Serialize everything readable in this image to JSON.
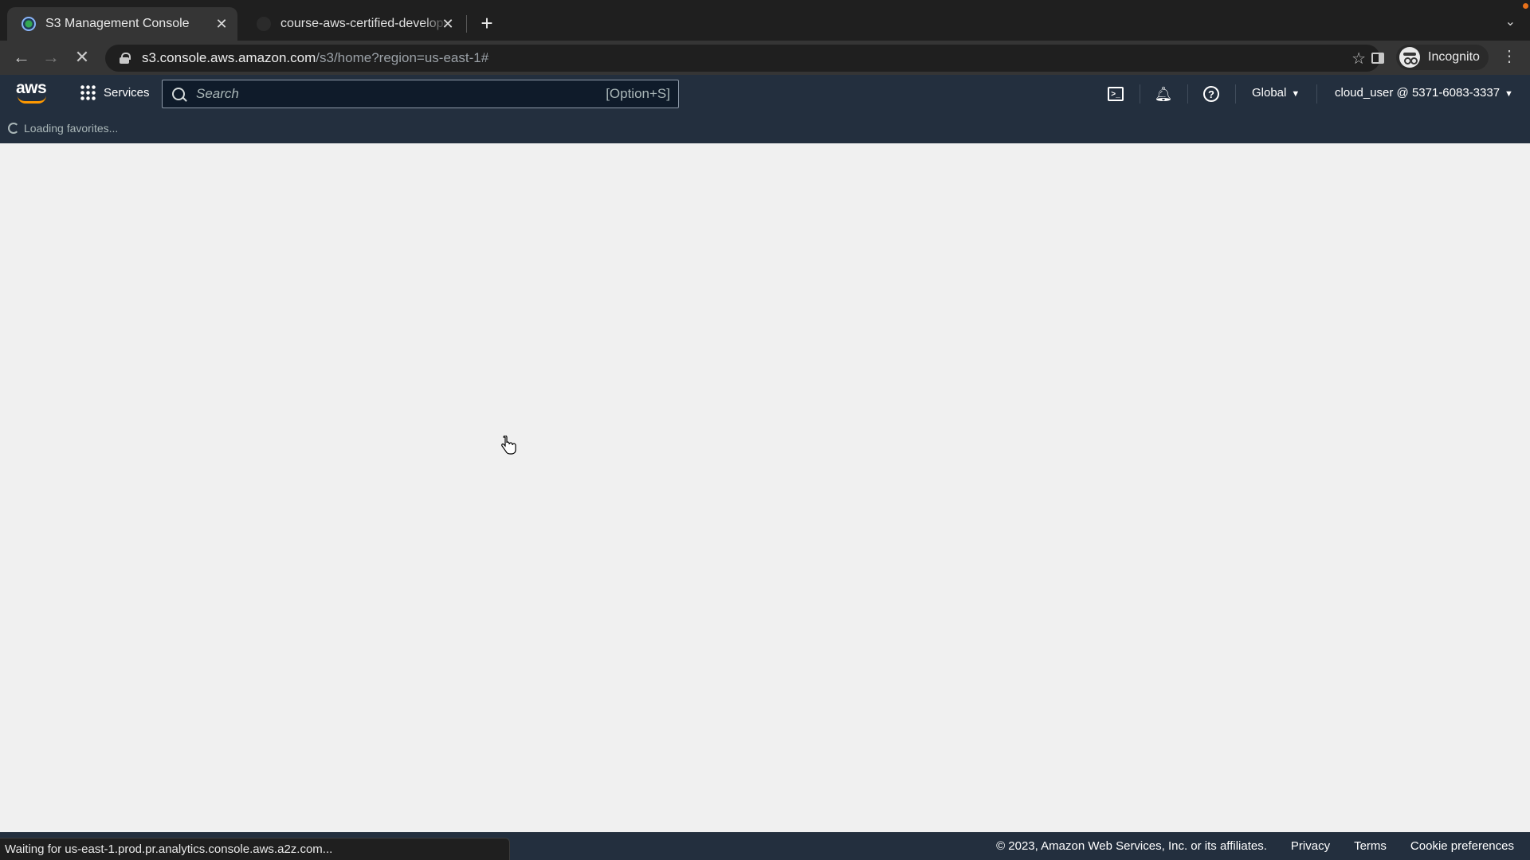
{
  "browser": {
    "tabs": [
      {
        "title": "S3 Management Console",
        "active": true
      },
      {
        "title": "course-aws-certified-developer",
        "active": false
      }
    ],
    "url": {
      "host": "s3.console.aws.amazon.com",
      "path": "/s3/home?region=us-east-1#"
    },
    "profile_label": "Incognito",
    "status_text": "Waiting for us-east-1.prod.pr.analytics.console.aws.a2z.com..."
  },
  "aws_nav": {
    "logo_text": "aws",
    "services_label": "Services",
    "search_placeholder": "Search",
    "search_shortcut": "[Option+S]",
    "region_label": "Global",
    "account_label": "cloud_user @ 5371-6083-3337"
  },
  "favorites": {
    "loading_text": "Loading favorites..."
  },
  "footer": {
    "copyright": "© 2023, Amazon Web Services, Inc. or its affiliates.",
    "links": [
      "Privacy",
      "Terms",
      "Cookie preferences"
    ]
  },
  "colors": {
    "aws_nav_bg": "#232f3e",
    "aws_orange": "#ff9900",
    "content_bg": "#f0f0f0"
  },
  "icons": [
    "back-arrow-icon",
    "forward-arrow-icon",
    "stop-loading-icon",
    "lock-icon",
    "star-icon",
    "side-panel-icon",
    "incognito-icon",
    "more-menu-icon",
    "grid-icon",
    "search-icon",
    "cloudshell-icon",
    "bell-icon",
    "help-icon",
    "caret-down-icon",
    "spinner-icon",
    "hand-cursor-icon"
  ]
}
